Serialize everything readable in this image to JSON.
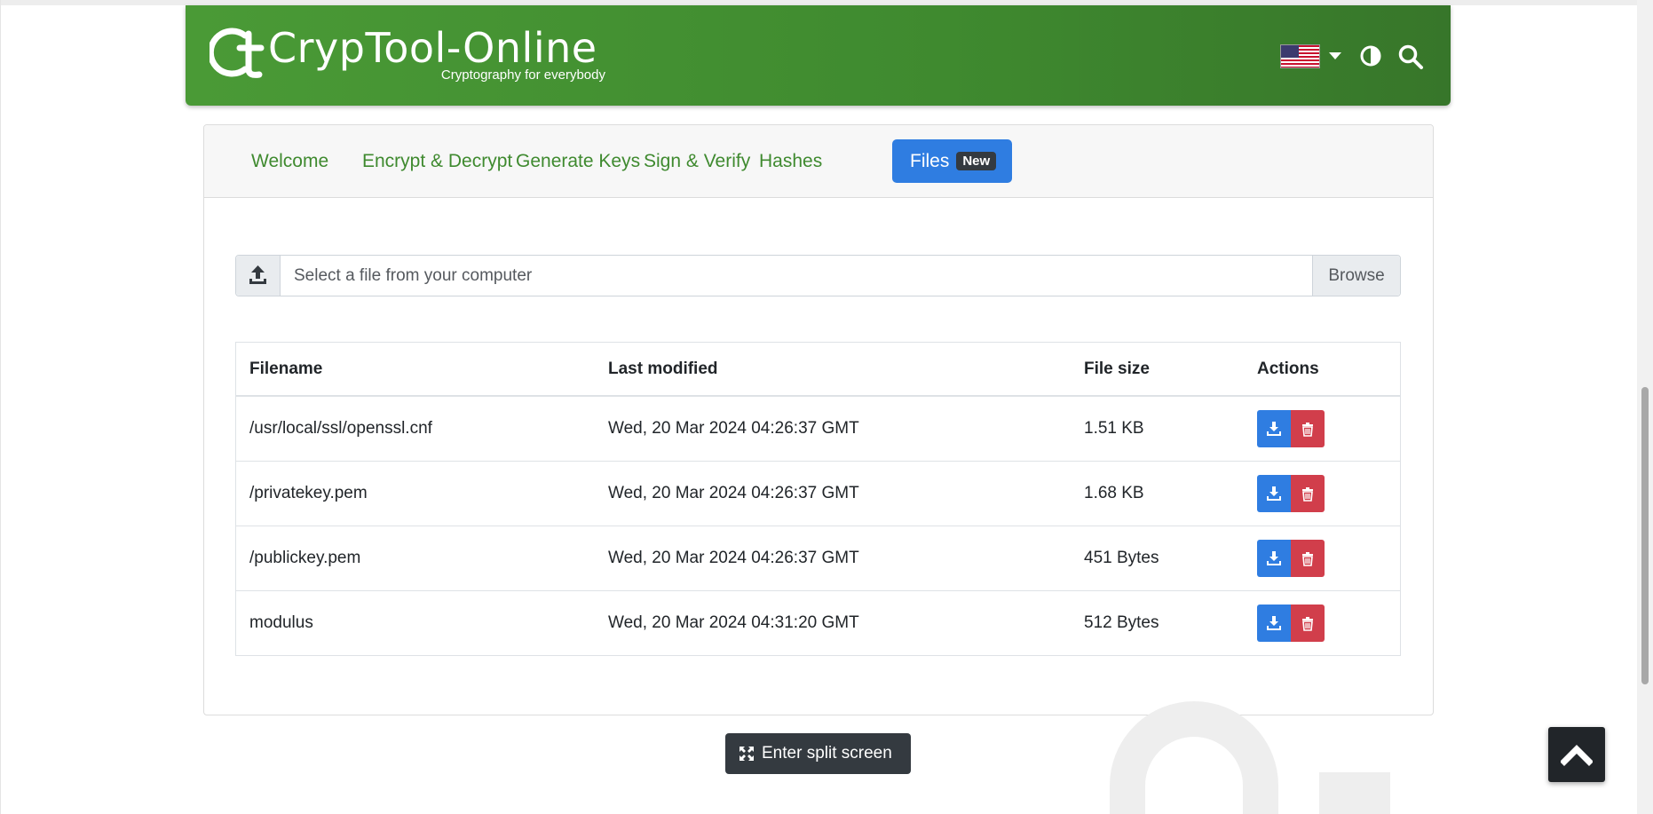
{
  "header": {
    "title": "CrypTool-Online",
    "subtitle": "Cryptography for everybody",
    "language_icon": "us-flag-icon",
    "theme_icon": "contrast-icon",
    "search_icon": "search-icon",
    "brand_color": "#3f8a2f"
  },
  "tabs": [
    {
      "label": "Welcome",
      "active": false
    },
    {
      "label": "Encrypt & Decrypt",
      "active": false
    },
    {
      "label": "Generate Keys",
      "active": false
    },
    {
      "label": "Sign & Verify",
      "active": false
    },
    {
      "label": "Hashes",
      "active": false
    },
    {
      "label": "Files",
      "active": true,
      "badge": "New"
    }
  ],
  "file_input": {
    "placeholder": "Select a file from your computer",
    "browse_label": "Browse",
    "icon": "upload-icon"
  },
  "files_table": {
    "columns": [
      "Filename",
      "Last modified",
      "File size",
      "Actions"
    ],
    "rows": [
      {
        "filename": "/usr/local/ssl/openssl.cnf",
        "modified": "Wed, 20 Mar 2024 04:26:37 GMT",
        "size": "1.51 KB"
      },
      {
        "filename": "/privatekey.pem",
        "modified": "Wed, 20 Mar 2024 04:26:37 GMT",
        "size": "1.68 KB"
      },
      {
        "filename": "/publickey.pem",
        "modified": "Wed, 20 Mar 2024 04:26:37 GMT",
        "size": "451 Bytes"
      },
      {
        "filename": "modulus",
        "modified": "Wed, 20 Mar 2024 04:31:20 GMT",
        "size": "512 Bytes"
      }
    ],
    "action_icons": [
      "download-icon",
      "trash-icon"
    ],
    "action_colors": {
      "download": "#2f7de1",
      "delete": "#d13e4b"
    }
  },
  "split_screen": {
    "label": "Enter split screen",
    "icon": "expand-icon"
  },
  "back_to_top": {
    "icon": "chevron-up-icon"
  }
}
